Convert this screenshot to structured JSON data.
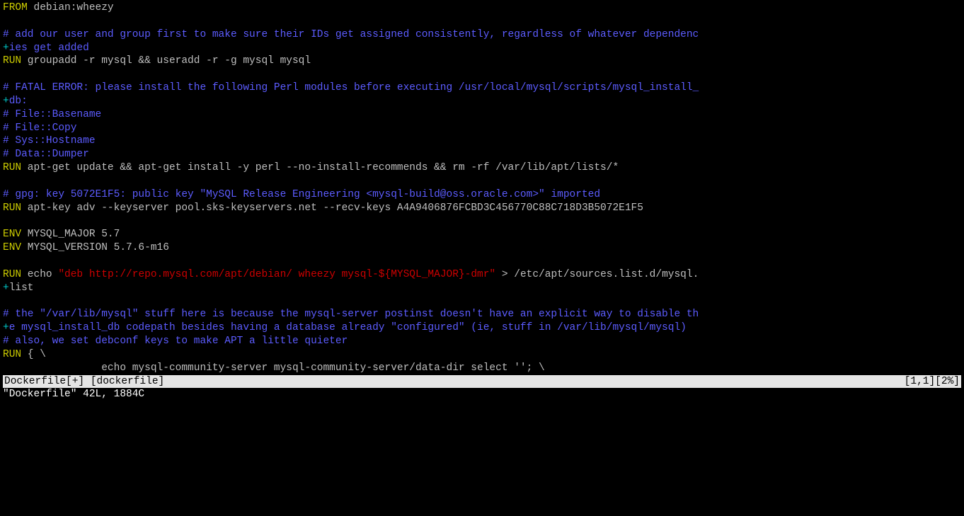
{
  "lines": [
    {
      "segments": [
        {
          "c": "kw",
          "t": "FROM"
        },
        {
          "c": "arg",
          "t": " debian:wheezy"
        }
      ]
    },
    {
      "segments": []
    },
    {
      "segments": [
        {
          "c": "cm",
          "t": "# add our user and group first to make sure their IDs get assigned consistently, regardless of whatever dependenc"
        }
      ]
    },
    {
      "segments": [
        {
          "c": "wrap",
          "t": "+"
        },
        {
          "c": "cm",
          "t": "ies get added"
        }
      ]
    },
    {
      "segments": [
        {
          "c": "kw",
          "t": "RUN"
        },
        {
          "c": "arg",
          "t": " groupadd -r mysql && useradd -r -g mysql mysql"
        }
      ]
    },
    {
      "segments": []
    },
    {
      "segments": [
        {
          "c": "cm",
          "t": "# FATAL ERROR: please install the following Perl modules before executing /usr/local/mysql/scripts/mysql_install_"
        }
      ]
    },
    {
      "segments": [
        {
          "c": "wrap",
          "t": "+"
        },
        {
          "c": "cm",
          "t": "db:"
        }
      ]
    },
    {
      "segments": [
        {
          "c": "cm",
          "t": "# File::Basename"
        }
      ]
    },
    {
      "segments": [
        {
          "c": "cm",
          "t": "# File::Copy"
        }
      ]
    },
    {
      "segments": [
        {
          "c": "cm",
          "t": "# Sys::Hostname"
        }
      ]
    },
    {
      "segments": [
        {
          "c": "cm",
          "t": "# Data::Dumper"
        }
      ]
    },
    {
      "segments": [
        {
          "c": "kw",
          "t": "RUN"
        },
        {
          "c": "arg",
          "t": " apt-get update && apt-get install -y perl --no-install-recommends && rm -rf /var/lib/apt/lists/*"
        }
      ]
    },
    {
      "segments": []
    },
    {
      "segments": [
        {
          "c": "cm",
          "t": "# gpg: key 5072E1F5: public key \"MySQL Release Engineering <mysql-build@oss.oracle.com>\" imported"
        }
      ]
    },
    {
      "segments": [
        {
          "c": "kw",
          "t": "RUN"
        },
        {
          "c": "arg",
          "t": " apt-key adv --keyserver pool.sks-keyservers.net --recv-keys A4A9406876FCBD3C456770C88C718D3B5072E1F5"
        }
      ]
    },
    {
      "segments": []
    },
    {
      "segments": [
        {
          "c": "kw",
          "t": "ENV"
        },
        {
          "c": "arg",
          "t": " MYSQL_MAJOR 5.7"
        }
      ]
    },
    {
      "segments": [
        {
          "c": "kw",
          "t": "ENV"
        },
        {
          "c": "arg",
          "t": " MYSQL_VERSION 5.7.6-m16"
        }
      ]
    },
    {
      "segments": []
    },
    {
      "segments": [
        {
          "c": "kw",
          "t": "RUN"
        },
        {
          "c": "arg",
          "t": " echo "
        },
        {
          "c": "str",
          "t": "\"deb http://repo.mysql.com/apt/debian/ wheezy mysql-${MYSQL_MAJOR}-dmr\""
        },
        {
          "c": "arg",
          "t": " > /etc/apt/sources.list.d/mysql."
        }
      ]
    },
    {
      "segments": [
        {
          "c": "wrap",
          "t": "+"
        },
        {
          "c": "arg",
          "t": "list"
        }
      ]
    },
    {
      "segments": []
    },
    {
      "segments": [
        {
          "c": "cm",
          "t": "# the \"/var/lib/mysql\" stuff here is because the mysql-server postinst doesn't have an explicit way to disable th"
        }
      ]
    },
    {
      "segments": [
        {
          "c": "wrap",
          "t": "+"
        },
        {
          "c": "cm",
          "t": "e mysql_install_db codepath besides having a database already \"configured\" (ie, stuff in /var/lib/mysql/mysql)"
        }
      ]
    },
    {
      "segments": [
        {
          "c": "cm",
          "t": "# also, we set debconf keys to make APT a little quieter"
        }
      ]
    },
    {
      "segments": [
        {
          "c": "kw",
          "t": "RUN"
        },
        {
          "c": "arg",
          "t": " { \\"
        }
      ]
    },
    {
      "segments": [
        {
          "c": "arg",
          "t": "                echo mysql-community-server mysql-community-server/data-dir select ''; \\"
        }
      ]
    }
  ],
  "status": {
    "left": "Dockerfile[+] [dockerfile]",
    "right": "[1,1][2%]"
  },
  "bottom": "\"Dockerfile\" 42L, 1884C"
}
